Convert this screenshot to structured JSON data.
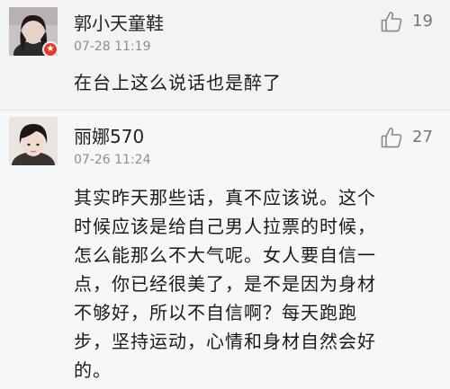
{
  "comments": [
    {
      "username": "郭小天童鞋",
      "time": "07-28 11:19",
      "likes": "19",
      "text": "在台上这么说话也是醉了",
      "avatar_icon": "user-avatar-photo",
      "badge_icon": "verified-badge-icon",
      "badge_color": "#e23b2e"
    },
    {
      "username": "丽娜570",
      "time": "07-26 11:24",
      "likes": "27",
      "text": "其实昨天那些话，真不应该说。这个\n时候应该是给自己男人拉票的时候，\n怎么能那么不大气呢。女人要自信一\n点，你已经很美了，是不是因为身材\n不够好，所以不自信啊？每天跑跑\n步，坚持运动，心情和身材自然会好\n的。",
      "avatar_icon": "user-avatar-photo"
    }
  ],
  "colors": {
    "background": "#f6f6f6",
    "meta_text": "#8e8e8e",
    "like_icon": "#888888"
  }
}
